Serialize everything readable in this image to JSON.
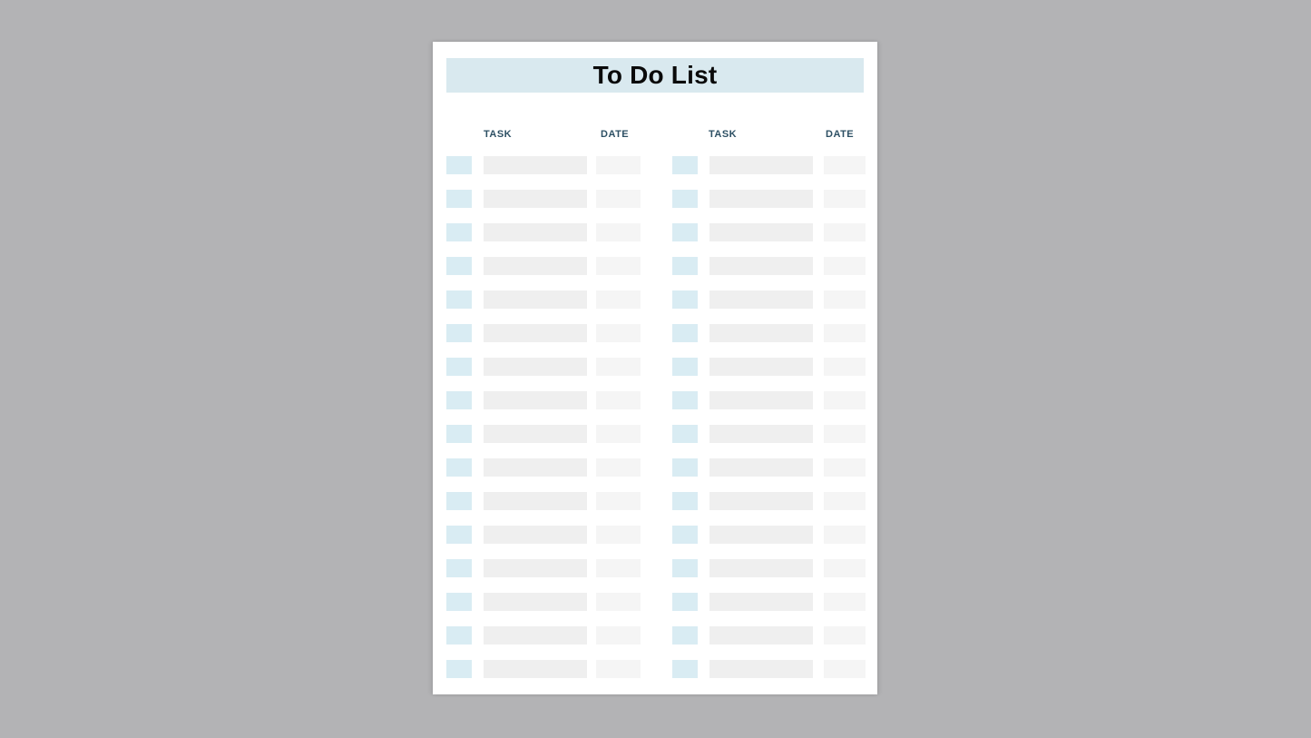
{
  "app": {
    "background_color": "#b3b3b5",
    "page_color": "#ffffff"
  },
  "header": {
    "title": "To Do List",
    "banner_color": "#d9e9ef",
    "title_color": "#0a0a0a"
  },
  "columns": {
    "header_color": "#2d5064",
    "left": [
      {
        "label": "TASK"
      },
      {
        "label": "DATE"
      }
    ],
    "right": [
      {
        "label": "TASK"
      },
      {
        "label": "DATE"
      }
    ]
  },
  "fields": {
    "checkbox_color": "#d9ecf3",
    "task_field_color": "#efefef",
    "date_field_color": "#f5f5f5"
  },
  "rows": {
    "count": 16,
    "items": [
      {
        "left": {
          "checked": false,
          "task": "",
          "date": ""
        },
        "right": {
          "checked": false,
          "task": "",
          "date": ""
        }
      },
      {
        "left": {
          "checked": false,
          "task": "",
          "date": ""
        },
        "right": {
          "checked": false,
          "task": "",
          "date": ""
        }
      },
      {
        "left": {
          "checked": false,
          "task": "",
          "date": ""
        },
        "right": {
          "checked": false,
          "task": "",
          "date": ""
        }
      },
      {
        "left": {
          "checked": false,
          "task": "",
          "date": ""
        },
        "right": {
          "checked": false,
          "task": "",
          "date": ""
        }
      },
      {
        "left": {
          "checked": false,
          "task": "",
          "date": ""
        },
        "right": {
          "checked": false,
          "task": "",
          "date": ""
        }
      },
      {
        "left": {
          "checked": false,
          "task": "",
          "date": ""
        },
        "right": {
          "checked": false,
          "task": "",
          "date": ""
        }
      },
      {
        "left": {
          "checked": false,
          "task": "",
          "date": ""
        },
        "right": {
          "checked": false,
          "task": "",
          "date": ""
        }
      },
      {
        "left": {
          "checked": false,
          "task": "",
          "date": ""
        },
        "right": {
          "checked": false,
          "task": "",
          "date": ""
        }
      },
      {
        "left": {
          "checked": false,
          "task": "",
          "date": ""
        },
        "right": {
          "checked": false,
          "task": "",
          "date": ""
        }
      },
      {
        "left": {
          "checked": false,
          "task": "",
          "date": ""
        },
        "right": {
          "checked": false,
          "task": "",
          "date": ""
        }
      },
      {
        "left": {
          "checked": false,
          "task": "",
          "date": ""
        },
        "right": {
          "checked": false,
          "task": "",
          "date": ""
        }
      },
      {
        "left": {
          "checked": false,
          "task": "",
          "date": ""
        },
        "right": {
          "checked": false,
          "task": "",
          "date": ""
        }
      },
      {
        "left": {
          "checked": false,
          "task": "",
          "date": ""
        },
        "right": {
          "checked": false,
          "task": "",
          "date": ""
        }
      },
      {
        "left": {
          "checked": false,
          "task": "",
          "date": ""
        },
        "right": {
          "checked": false,
          "task": "",
          "date": ""
        }
      },
      {
        "left": {
          "checked": false,
          "task": "",
          "date": ""
        },
        "right": {
          "checked": false,
          "task": "",
          "date": ""
        }
      },
      {
        "left": {
          "checked": false,
          "task": "",
          "date": ""
        },
        "right": {
          "checked": false,
          "task": "",
          "date": ""
        }
      }
    ]
  }
}
